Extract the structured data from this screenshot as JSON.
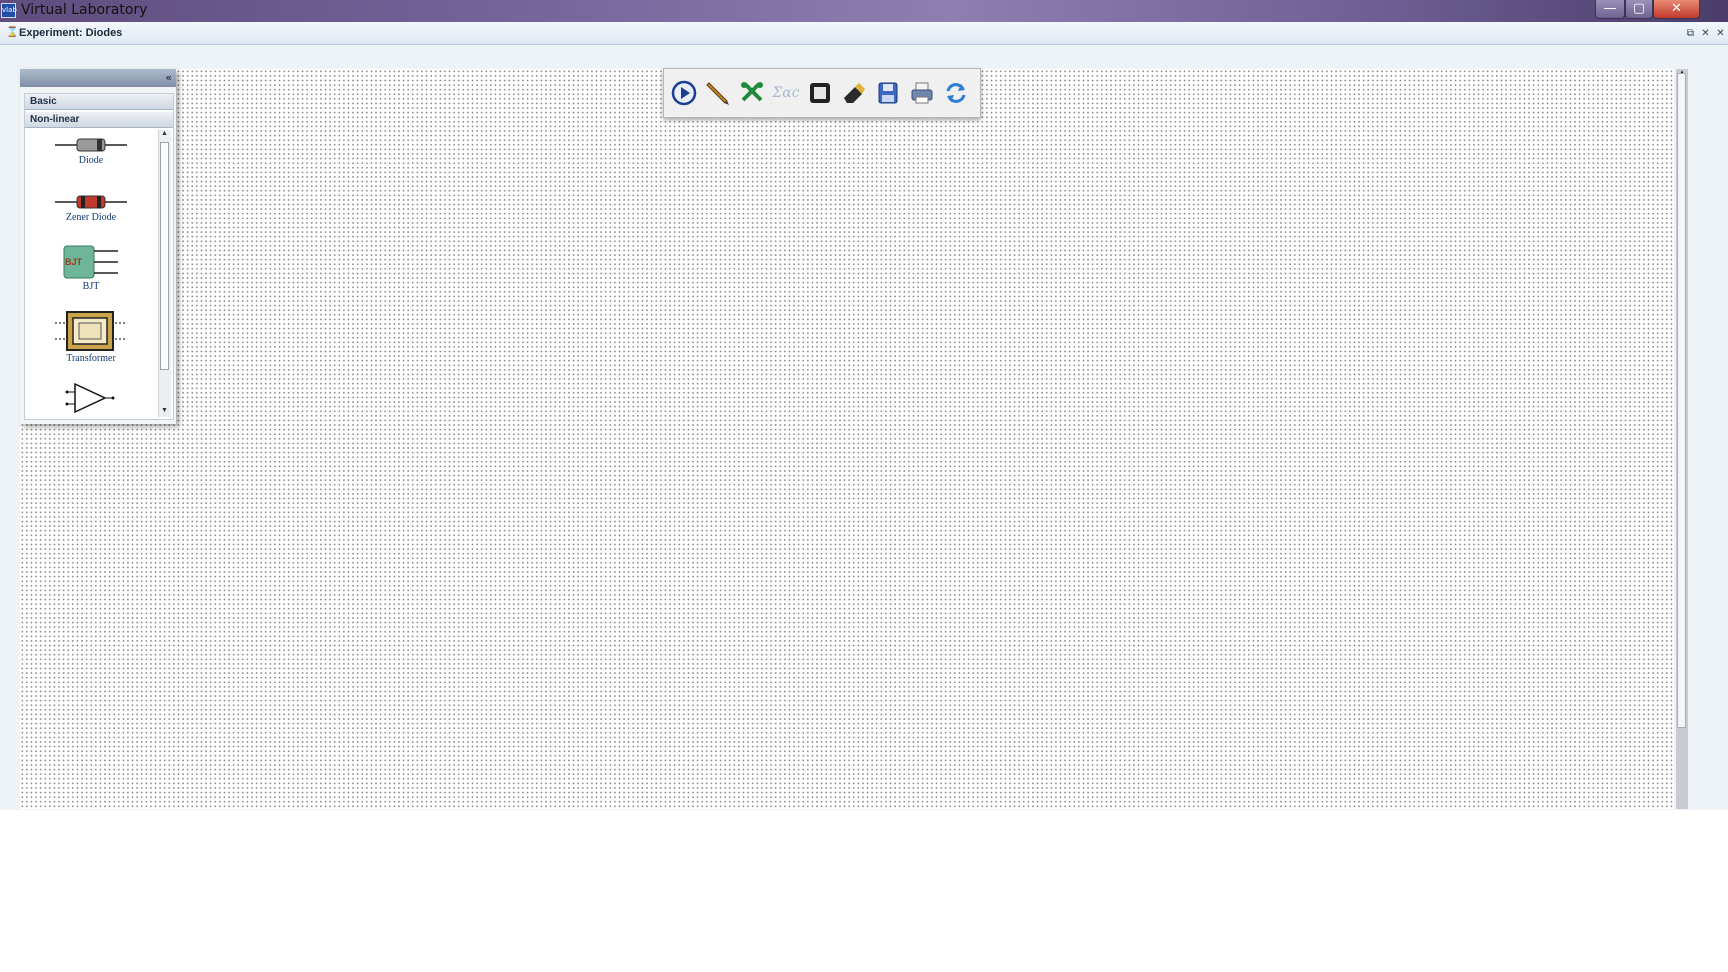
{
  "window": {
    "title": "Virtual Laboratory",
    "icon_text": "vlab",
    "controls": {
      "minimize": "—",
      "maximize": "▢",
      "close": "✕"
    }
  },
  "experiment": {
    "title": "Experiment: Diodes",
    "controls": {
      "restore": "⧉",
      "minimize": "✕",
      "close": "✕"
    }
  },
  "toolbar": {
    "buttons": [
      {
        "name": "play",
        "icon": "play-icon"
      },
      {
        "name": "wire",
        "icon": "pencil-icon"
      },
      {
        "name": "tools",
        "icon": "tools-icon"
      },
      {
        "name": "equation",
        "icon": "sigma-icon",
        "label": "Σαc",
        "disabled": true
      },
      {
        "name": "stop",
        "icon": "stop-icon"
      },
      {
        "name": "eraser",
        "icon": "eraser-icon"
      },
      {
        "name": "save",
        "icon": "save-icon"
      },
      {
        "name": "print",
        "icon": "printer-icon"
      },
      {
        "name": "refresh",
        "icon": "refresh-icon"
      }
    ]
  },
  "palette": {
    "collapse_glyph": "«",
    "groups": [
      "Basic",
      "Non-linear"
    ],
    "items": [
      {
        "label": "Diode",
        "icon": "diode-icon"
      },
      {
        "label": "Zener Diode",
        "icon": "zener-diode-icon"
      },
      {
        "label": "BJT",
        "icon": "bjt-icon",
        "badge": "BJT"
      },
      {
        "label": "Transformer",
        "icon": "transformer-icon"
      },
      {
        "label": "",
        "icon": "op-amp-icon"
      }
    ]
  },
  "colors": {
    "canvas_dots": "#8a8a8a",
    "title_bar": "#6d5f93",
    "close_button": "#c0392b",
    "label_text": "#123a7a"
  }
}
